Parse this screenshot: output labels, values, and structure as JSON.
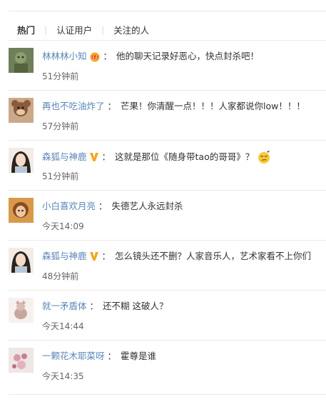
{
  "tabs": [
    {
      "label": "热门",
      "active": true
    },
    {
      "label": "认证用户",
      "active": false
    },
    {
      "label": "关注的人",
      "active": false
    }
  ],
  "comments": [
    {
      "user": "林林林小知",
      "badge": "crown",
      "text": "他的聊天记录好恶心，快点封杀吧！",
      "time": "51分钟前"
    },
    {
      "user": "再也不吃油炸了",
      "badge": "",
      "text": "芒果！你清醒一点！！！人家都说你low！！！",
      "time": "57分钟前"
    },
    {
      "user": "森狐与神鹿",
      "badge": "verified-v",
      "text": "这就是那位《随身带tao的哥哥》？",
      "emoji": "smirk-emoji",
      "time": "51分钟前"
    },
    {
      "user": "小白喜欢月亮",
      "badge": "",
      "text": "失德艺人永远封杀",
      "time": "今天14:09"
    },
    {
      "user": "森狐与神鹿",
      "badge": "verified-v",
      "text": "怎么镜头还不删？人家音乐人，艺术家看不上你们",
      "time": "48分钟前"
    },
    {
      "user": "就一矛盾体",
      "badge": "",
      "text": "还不糊 这破人？",
      "time": "今天14:44"
    },
    {
      "user": "一颗花木耶菜呀",
      "badge": "",
      "text": "霍尊是谁",
      "time": "今天14:35"
    }
  ],
  "colors": {
    "username": "#5a86b8",
    "badge_gold": "#f5a623",
    "divider": "#eaeaea"
  }
}
